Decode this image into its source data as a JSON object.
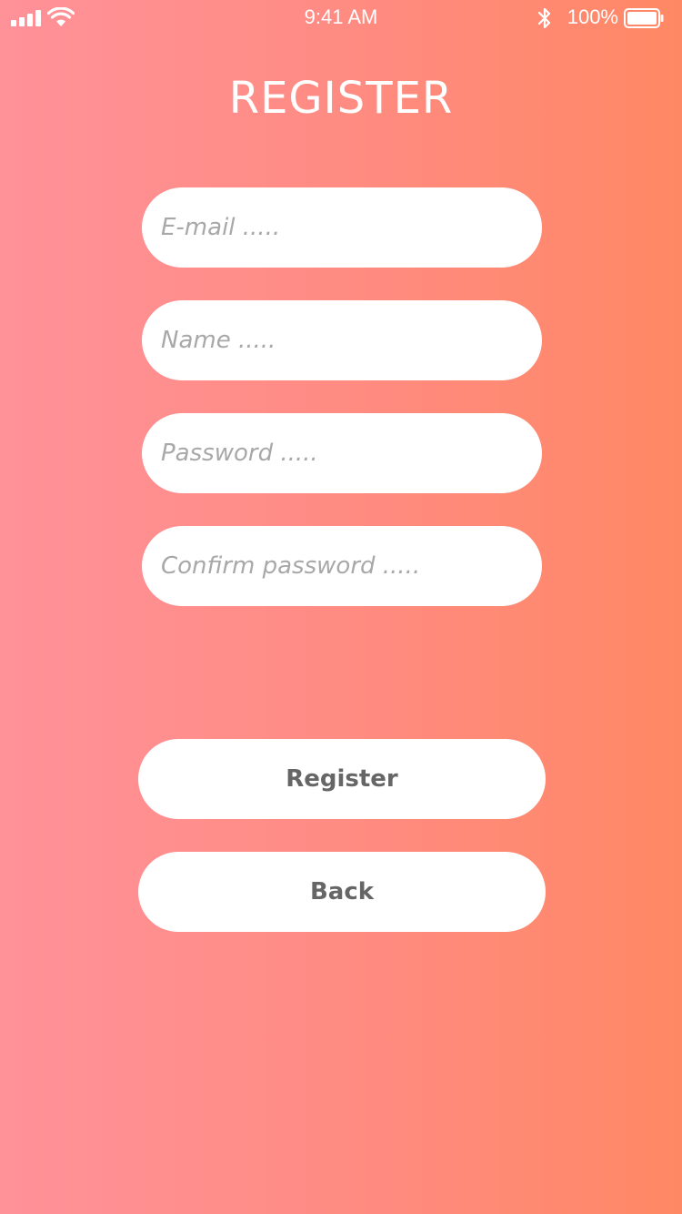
{
  "status_bar": {
    "time": "9:41 AM",
    "battery_percent": "100%",
    "icons": [
      "signal-icon",
      "wifi-icon",
      "bluetooth-icon",
      "battery-icon"
    ]
  },
  "page": {
    "title": "REGISTER"
  },
  "form": {
    "email_placeholder": "E-mail .....",
    "name_placeholder": "Name .....",
    "password_placeholder": "Password .....",
    "confirm_placeholder": "Confirm password ....."
  },
  "actions": {
    "register_label": "Register",
    "back_label": "Back"
  },
  "colors": {
    "gradient_left": "#ff9199",
    "gradient_right": "#ff8864",
    "field_background": "#ffffff",
    "button_text": "#666666",
    "placeholder_text": "#a8a8a8"
  }
}
